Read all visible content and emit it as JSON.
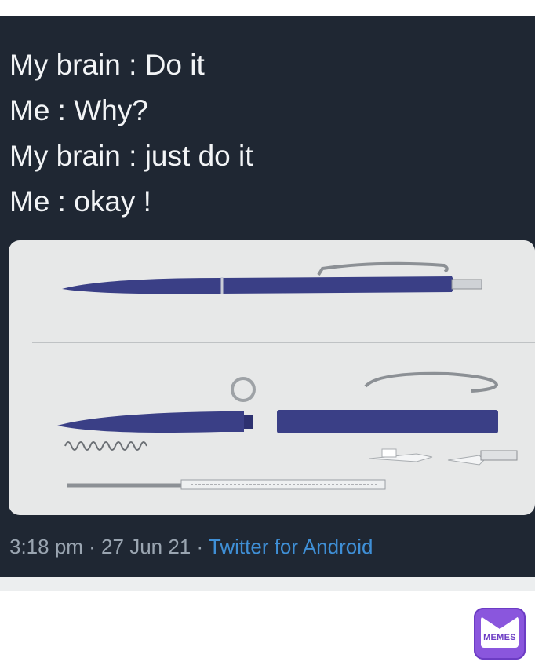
{
  "tweet": {
    "lines": [
      "My brain : Do it",
      "Me : Why?",
      "My brain : just do it",
      "Me : okay !"
    ],
    "timestamp": "3:18 pm · 27 Jun 21 ·",
    "source": "Twitter for Android"
  },
  "watermark": {
    "label": "MEMES",
    "accent": "#8a56dd"
  },
  "colors": {
    "card_background": "#1f2733",
    "text": "#f2f4f6",
    "meta": "#9aa5b1",
    "link": "#3f8fd6",
    "pen_blue": "#3a3f86"
  }
}
